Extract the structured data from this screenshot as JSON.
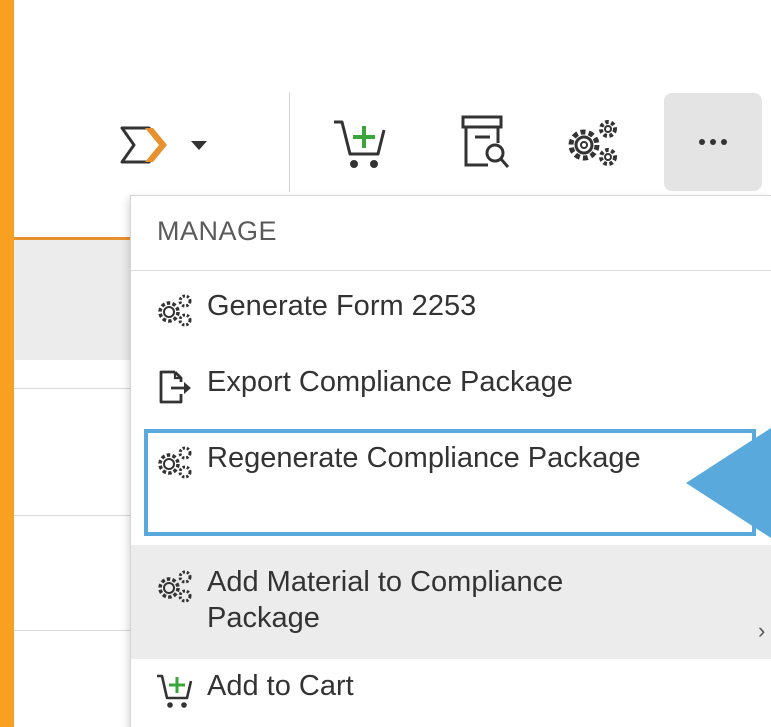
{
  "toolbar": {
    "actions_icon": "chevron-arrow-icon",
    "cart_icon": "add-cart-icon",
    "archive_icon": "archive-search-icon",
    "settings_icon": "gears-icon",
    "more_icon": "ellipsis-icon"
  },
  "menu": {
    "header": "MANAGE",
    "items": [
      {
        "label": "Generate Form 2253",
        "icon": "gears-icon"
      },
      {
        "label": "Export Compliance Package",
        "icon": "export-icon"
      },
      {
        "label": "Regenerate Compliance Package",
        "icon": "gears-icon"
      },
      {
        "label": "Add Material to Compliance Package",
        "icon": "gears-icon"
      },
      {
        "label": "Add to Cart",
        "icon": "add-cart-icon"
      }
    ]
  },
  "colors": {
    "frame": "#f7a021",
    "accent_line": "#e8912f",
    "highlight": "#5aa9dc",
    "cart_plus": "#3aa53a"
  }
}
